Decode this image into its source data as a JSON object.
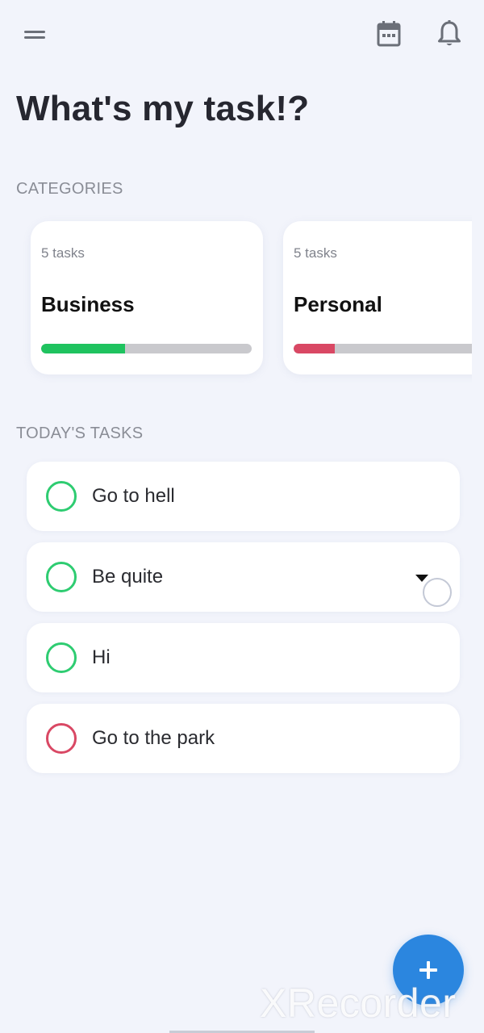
{
  "header": {
    "menu_icon": "menu-icon",
    "calendar_icon": "calendar-icon",
    "notifications_icon": "bell-icon"
  },
  "page_title": "What's my task!?",
  "categories": {
    "label": "CATEGORIES",
    "items": [
      {
        "count_text": "5 tasks",
        "name": "Business",
        "progress": 0.4,
        "color": "#1fc35f"
      },
      {
        "count_text": "5 tasks",
        "name": "Personal",
        "progress": 0.17,
        "color": "#d94864"
      }
    ]
  },
  "today": {
    "label": "TODAY'S TASKS",
    "tasks": [
      {
        "title": "Go to hell",
        "color": "#2ecc71"
      },
      {
        "title": "Be quite",
        "color": "#2ecc71"
      },
      {
        "title": "Hi",
        "color": "#2ecc71"
      },
      {
        "title": "Go to the park",
        "color": "#d94864"
      }
    ]
  },
  "fab": {
    "icon": "plus-icon"
  },
  "watermark": "XRecorder",
  "colors": {
    "background": "#f2f4fb",
    "accent": "#2b86df",
    "business": "#1fc35f",
    "personal": "#d94864"
  }
}
